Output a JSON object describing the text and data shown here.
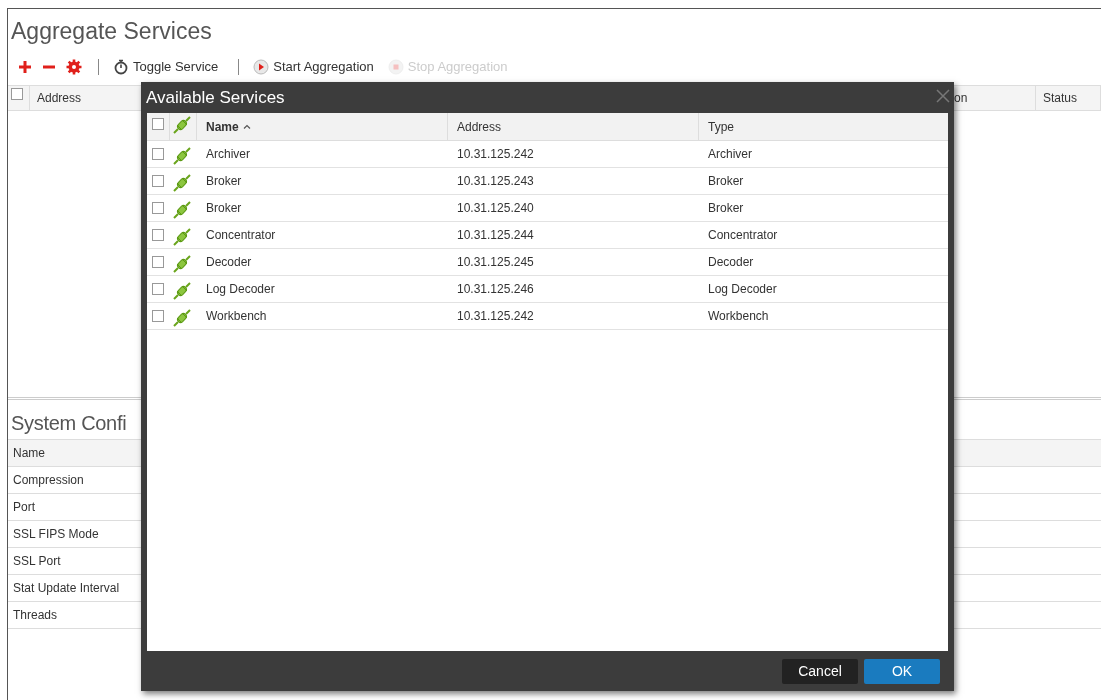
{
  "page": {
    "title": "Aggregate Services"
  },
  "toolbar": [
    {
      "kind": "add",
      "disabled": false
    },
    {
      "kind": "remove",
      "disabled": false
    },
    {
      "kind": "settings",
      "disabled": false
    },
    {
      "kind": "toggle",
      "label": "Toggle Service",
      "disabled": false
    },
    {
      "kind": "start",
      "label": "Start Aggregation",
      "disabled": false
    },
    {
      "kind": "stop",
      "label": "Stop Aggregation",
      "disabled": true
    }
  ],
  "services_table": {
    "select_all_checked": false,
    "columns": [
      "Address",
      "on",
      "Status"
    ]
  },
  "system_config": {
    "title": "System Confi",
    "columns": [
      "Name"
    ],
    "rows": [
      "Compression",
      "Port",
      "SSL FIPS Mode",
      "SSL Port",
      "Stat Update Interval",
      "Threads"
    ]
  },
  "dialog": {
    "title": "Available Services",
    "select_all_checked": false,
    "columns": [
      "Name",
      "Address",
      "Type"
    ],
    "rows": [
      {
        "checked": false,
        "name": "Archiver",
        "address": "10.31.125.242",
        "type": "Archiver"
      },
      {
        "checked": false,
        "name": "Broker",
        "address": "10.31.125.243",
        "type": "Broker"
      },
      {
        "checked": false,
        "name": "Broker",
        "address": "10.31.125.240",
        "type": "Broker"
      },
      {
        "checked": false,
        "name": "Concentrator",
        "address": "10.31.125.244",
        "type": "Concentrator"
      },
      {
        "checked": false,
        "name": "Decoder",
        "address": "10.31.125.245",
        "type": "Decoder"
      },
      {
        "checked": false,
        "name": "Log Decoder",
        "address": "10.31.125.246",
        "type": "Log Decoder"
      },
      {
        "checked": false,
        "name": "Workbench",
        "address": "10.31.125.242",
        "type": "Workbench"
      }
    ],
    "buttons": [
      {
        "kind": "secondary",
        "label": "Cancel"
      },
      {
        "kind": "primary",
        "label": "OK"
      }
    ]
  }
}
